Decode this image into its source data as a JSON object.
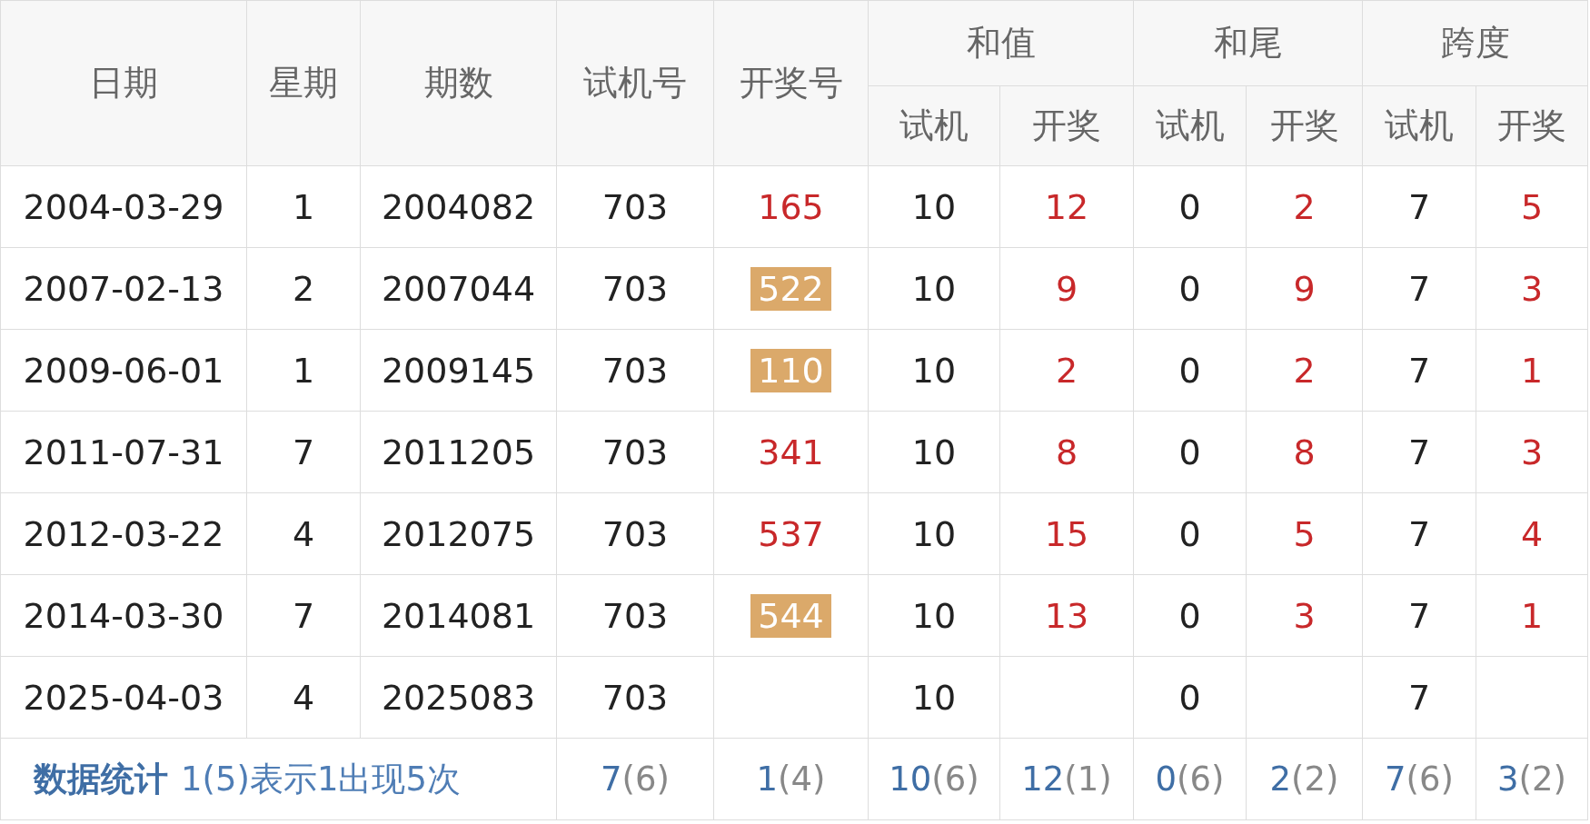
{
  "table": {
    "columns": [
      {
        "label": "日期"
      },
      {
        "label": "星期"
      },
      {
        "label": "期数"
      },
      {
        "label": "试机号"
      },
      {
        "label": "开奖号"
      }
    ],
    "groups": [
      {
        "label": "和值",
        "sub": [
          "试机",
          "开奖"
        ]
      },
      {
        "label": "和尾",
        "sub": [
          "试机",
          "开奖"
        ]
      },
      {
        "label": "跨度",
        "sub": [
          "试机",
          "开奖"
        ]
      }
    ],
    "rows": [
      {
        "date": "2004-03-29",
        "weekday": "1",
        "issue": "2004082",
        "test": "703",
        "draw": "165",
        "highlighted": false,
        "sum_test": "10",
        "sum_draw": "12",
        "tail_test": "0",
        "tail_draw": "2",
        "span_test": "7",
        "span_draw": "5"
      },
      {
        "date": "2007-02-13",
        "weekday": "2",
        "issue": "2007044",
        "test": "703",
        "draw": "522",
        "highlighted": true,
        "sum_test": "10",
        "sum_draw": "9",
        "tail_test": "0",
        "tail_draw": "9",
        "span_test": "7",
        "span_draw": "3"
      },
      {
        "date": "2009-06-01",
        "weekday": "1",
        "issue": "2009145",
        "test": "703",
        "draw": "110",
        "highlighted": true,
        "sum_test": "10",
        "sum_draw": "2",
        "tail_test": "0",
        "tail_draw": "2",
        "span_test": "7",
        "span_draw": "1"
      },
      {
        "date": "2011-07-31",
        "weekday": "7",
        "issue": "2011205",
        "test": "703",
        "draw": "341",
        "highlighted": false,
        "sum_test": "10",
        "sum_draw": "8",
        "tail_test": "0",
        "tail_draw": "8",
        "span_test": "7",
        "span_draw": "3"
      },
      {
        "date": "2012-03-22",
        "weekday": "4",
        "issue": "2012075",
        "test": "703",
        "draw": "537",
        "highlighted": false,
        "sum_test": "10",
        "sum_draw": "15",
        "tail_test": "0",
        "tail_draw": "5",
        "span_test": "7",
        "span_draw": "4"
      },
      {
        "date": "2014-03-30",
        "weekday": "7",
        "issue": "2014081",
        "test": "703",
        "draw": "544",
        "highlighted": true,
        "sum_test": "10",
        "sum_draw": "13",
        "tail_test": "0",
        "tail_draw": "3",
        "span_test": "7",
        "span_draw": "1"
      },
      {
        "date": "2025-04-03",
        "weekday": "4",
        "issue": "2025083",
        "test": "703",
        "sum_test": "10",
        "tail_test": "0",
        "span_test": "7"
      }
    ],
    "footer": {
      "title": "数据统计",
      "legend": "1(5)表示1出现5次",
      "stats": [
        {
          "value": "7",
          "count": "(6)"
        },
        {
          "value": "1",
          "count": "(4)"
        },
        {
          "value": "10",
          "count": "(6)"
        },
        {
          "value": "12",
          "count": "(1)"
        },
        {
          "value": "0",
          "count": "(6)"
        },
        {
          "value": "2",
          "count": "(2)"
        },
        {
          "value": "7",
          "count": "(6)"
        },
        {
          "value": "3",
          "count": "(2)"
        }
      ]
    }
  }
}
